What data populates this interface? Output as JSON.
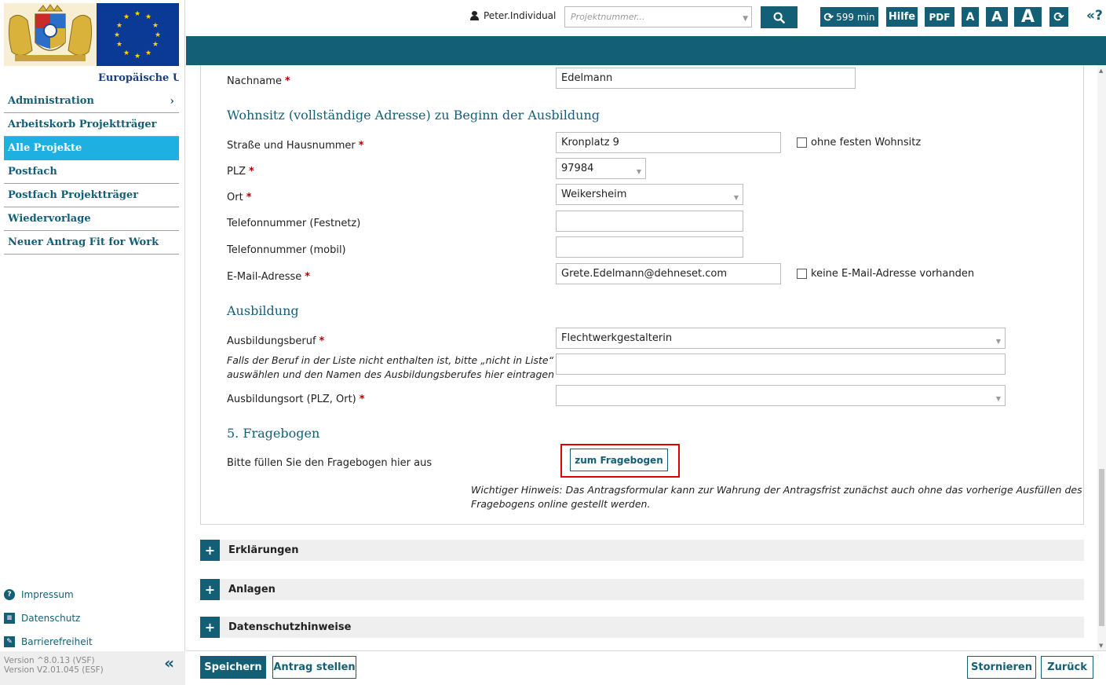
{
  "sidebar": {
    "eu_caption": "Europäische Uni",
    "nav": [
      {
        "label": "Administration",
        "active": false,
        "has_submenu": true
      },
      {
        "label": "Arbeitskorb Projektträger",
        "active": false
      },
      {
        "label": "Alle Projekte",
        "active": true
      },
      {
        "label": "Postfach",
        "active": false
      },
      {
        "label": "Postfach Projektträger",
        "active": false
      },
      {
        "label": "Wiedervorlage",
        "active": false
      },
      {
        "label": "Neuer Antrag Fit for Work",
        "active": false
      }
    ],
    "footer_links": [
      {
        "label": "Impressum",
        "icon": "help-circle-icon"
      },
      {
        "label": "Datenschutz",
        "icon": "id-card-icon"
      },
      {
        "label": "Barrierefreiheit",
        "icon": "edit-icon"
      }
    ],
    "version_line1": "Version ^8.0.13 (VSF)",
    "version_line2": "Version V2.01.045 (ESF)"
  },
  "topbar": {
    "username": "Peter.Individual",
    "project_number_placeholder": "Projektnummer...",
    "session_timer": "599 min",
    "help_label": "Hilfe",
    "pdf_label": "PDF",
    "font_small": "A",
    "font_medium": "A",
    "font_large": "A"
  },
  "form": {
    "nachname_label": "Nachname",
    "nachname_value": "Edelmann",
    "wohnsitz_heading": "Wohnsitz (vollständige Adresse) zu Beginn der Ausbildung",
    "strasse_label": "Straße und Hausnummer",
    "strasse_value": "Kronplatz 9",
    "ohne_wohnsitz_label": "ohne festen Wohnsitz",
    "plz_label": "PLZ",
    "plz_value": "97984",
    "ort_label": "Ort",
    "ort_value": "Weikersheim",
    "tel_festnetz_label": "Telefonnummer (Festnetz)",
    "tel_festnetz_value": "",
    "tel_mobil_label": "Telefonnummer (mobil)",
    "tel_mobil_value": "",
    "email_label": "E-Mail-Adresse",
    "email_value": "Grete.Edelmann@dehneset.com",
    "keine_email_label": "keine E-Mail-Adresse vorhanden",
    "ausbildung_heading": "Ausbildung",
    "beruf_label": "Ausbildungsberuf",
    "beruf_value": "Flechtwerkgestalterin",
    "beruf_hint_line1": "Falls der Beruf in der Liste nicht enthalten ist, bitte „nicht in Liste“",
    "beruf_hint_line2": "auswählen und den Namen des Ausbildungsberufes hier eintragen",
    "beruf_other_value": "",
    "ort_ausbildung_label": "Ausbildungsort (PLZ, Ort)",
    "ort_ausbildung_value": "",
    "fragebogen_heading": "5. Fragebogen",
    "fragebogen_label": "Bitte füllen Sie den Fragebogen hier aus",
    "fragebogen_button": "zum Fragebogen",
    "hinweis_line1": "Wichtiger Hinweis: Das Antragsformular kann zur Wahrung der Antragsfrist zunächst auch ohne das vorherige Ausfüllen des",
    "hinweis_line2": "Fragebogens online gestellt werden."
  },
  "accordions": [
    {
      "label": "Erklärungen"
    },
    {
      "label": "Anlagen"
    },
    {
      "label": "Datenschutzhinweise"
    }
  ],
  "bottombar": {
    "save": "Speichern",
    "submit": "Antrag stellen",
    "cancel": "Stornieren",
    "back": "Zurück"
  },
  "colors": {
    "brand_teal": "#135f76",
    "active_nav": "#1eb0e1",
    "required": "#b00000",
    "highlight": "#e00000"
  }
}
